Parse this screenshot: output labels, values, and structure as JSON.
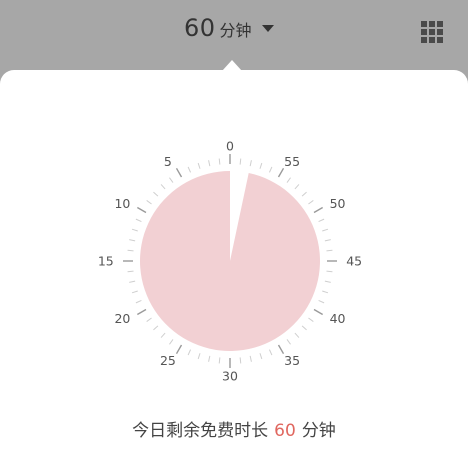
{
  "header": {
    "duration_value": "60",
    "duration_unit": "分钟",
    "menu_icon": "grid-icon",
    "dropdown_icon": "caret-down-icon"
  },
  "timer": {
    "labels": [
      "0",
      "5",
      "10",
      "15",
      "20",
      "25",
      "30",
      "35",
      "40",
      "45",
      "50",
      "55"
    ],
    "remaining_minutes": 58,
    "total_minutes": 60,
    "fill_color": "#f2d0d3"
  },
  "status": {
    "prefix": "今日剩余免费时长",
    "number": "60",
    "suffix": "分钟"
  },
  "colors": {
    "accent": "#e0675f",
    "topbar": "#a7a7a7"
  }
}
